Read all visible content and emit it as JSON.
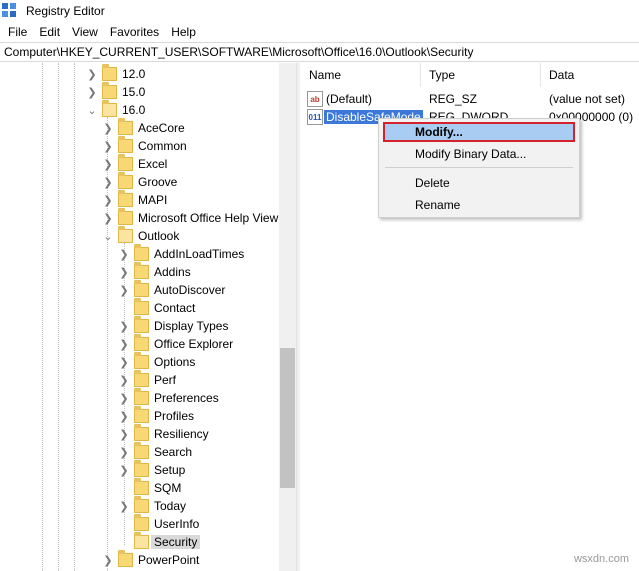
{
  "window": {
    "title": "Registry Editor"
  },
  "menu": [
    "File",
    "Edit",
    "View",
    "Favorites",
    "Help"
  ],
  "address": "Computer\\HKEY_CURRENT_USER\\SOFTWARE\\Microsoft\\Office\\16.0\\Outlook\\Security",
  "tree": {
    "versions": [
      {
        "label": "12.0",
        "expanded": false
      },
      {
        "label": "15.0",
        "expanded": false
      },
      {
        "label": "16.0",
        "expanded": true
      }
    ],
    "office16_children": [
      "AceCore",
      "Common",
      "Excel",
      "Groove",
      "MAPI",
      "Microsoft Office Help View",
      "Outlook"
    ],
    "outlook_children": [
      "AddInLoadTimes",
      "Addins",
      "AutoDiscover",
      "Contact",
      "Display Types",
      "Office Explorer",
      "Options",
      "Perf",
      "Preferences",
      "Profiles",
      "Resiliency",
      "Search",
      "Setup",
      "SQM",
      "Today",
      "UserInfo",
      "Security"
    ],
    "after_outlook": [
      "PowerPoint"
    ],
    "selected": "Security"
  },
  "columns": {
    "name": "Name",
    "type": "Type",
    "data": "Data"
  },
  "values": [
    {
      "icon": "string-value-icon",
      "icon_text": "ab",
      "name": "(Default)",
      "type": "REG_SZ",
      "data": "(value not set)"
    },
    {
      "icon": "dword-value-icon",
      "icon_text": "011",
      "name": "DisableSafeMode",
      "type": "REG_DWORD",
      "data": "0x00000000 (0)"
    }
  ],
  "context_menu": {
    "items": [
      "Modify...",
      "Modify Binary Data...",
      "Delete",
      "Rename"
    ],
    "highlighted": "Modify..."
  },
  "watermark": "wsxdn.com",
  "colors": {
    "selection": "#3b78d8",
    "highlight": "#a9cdf2",
    "highlight_border": "#d5202e",
    "folder": "#f8d775"
  }
}
